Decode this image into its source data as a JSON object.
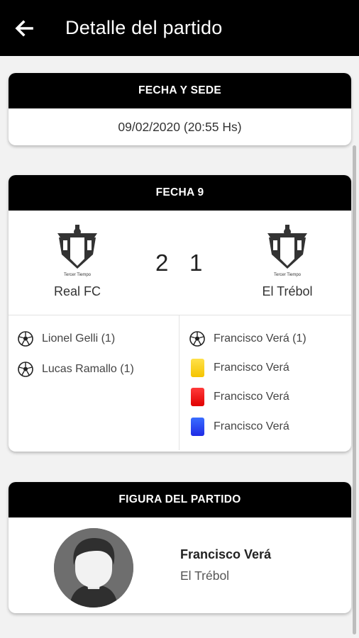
{
  "appbar": {
    "title": "Detalle del partido",
    "back_icon": "arrow-left-icon"
  },
  "date_card": {
    "header": "FECHA Y SEDE",
    "datetime": "09/02/2020 (20:55 Hs)"
  },
  "match_card": {
    "header": "FECHA 9",
    "home": {
      "name": "Real FC",
      "score": "2",
      "crest_text": "Tercer Tiempo"
    },
    "away": {
      "name": "El Trébol",
      "score": "1",
      "crest_text": "Tercer Tiempo"
    },
    "home_events": [
      {
        "type": "goal",
        "icon": "soccer-ball-icon",
        "text": "Lionel Gelli (1)"
      },
      {
        "type": "goal",
        "icon": "soccer-ball-icon",
        "text": "Lucas Ramallo (1)"
      }
    ],
    "away_events": [
      {
        "type": "goal",
        "icon": "soccer-ball-icon",
        "text": "Francisco Verá (1)"
      },
      {
        "type": "yellow_card",
        "icon": "yellow-card-icon",
        "text": "Francisco Verá"
      },
      {
        "type": "red_card",
        "icon": "red-card-icon",
        "text": "Francisco Verá"
      },
      {
        "type": "blue_card",
        "icon": "blue-card-icon",
        "text": "Francisco Verá"
      }
    ]
  },
  "figure_card": {
    "header": "FIGURA DEL PARTIDO",
    "player_name": "Francisco Verá",
    "player_team": "El Trébol",
    "avatar_icon": "player-avatar-icon"
  },
  "colors": {
    "header_bg": "#000000",
    "yellow": "#f5c400",
    "red": "#e00000",
    "blue": "#1f2be6"
  }
}
